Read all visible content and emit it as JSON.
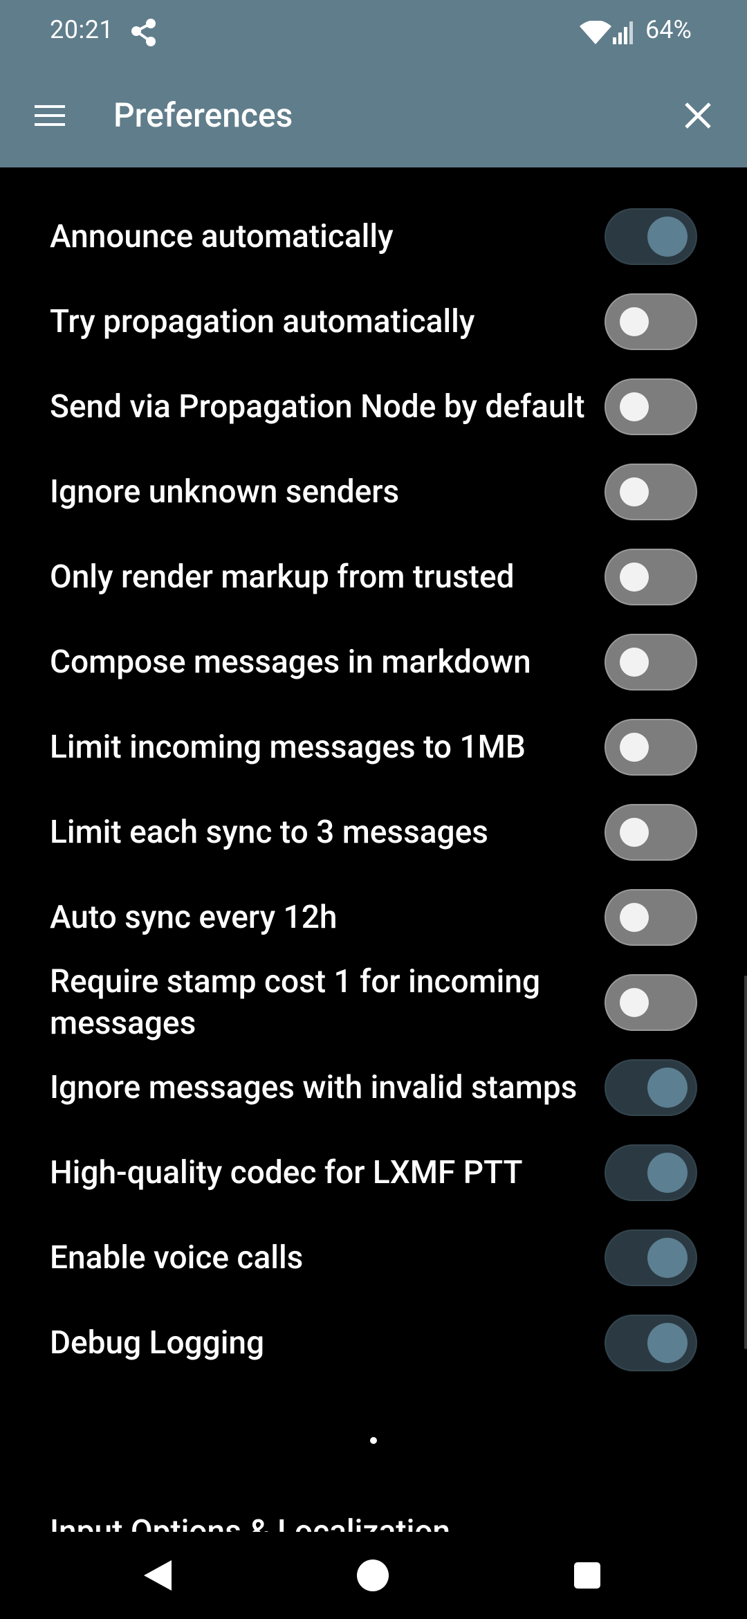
{
  "status_bar": {
    "time": "20:21",
    "battery_text": "64%",
    "icons": [
      "share-icon",
      "wifi-icon",
      "signal-icon"
    ]
  },
  "app_bar": {
    "title": "Preferences",
    "icons": [
      "menu-icon",
      "close-icon"
    ]
  },
  "settings": [
    {
      "label": "Announce automatically",
      "enabled": true
    },
    {
      "label": "Try propagation automatically",
      "enabled": false
    },
    {
      "label": "Send via Propagation Node by default",
      "enabled": false
    },
    {
      "label": "Ignore unknown senders",
      "enabled": false
    },
    {
      "label": "Only render markup from trusted",
      "enabled": false
    },
    {
      "label": "Compose messages in markdown",
      "enabled": false
    },
    {
      "label": "Limit incoming messages to 1MB",
      "enabled": false
    },
    {
      "label": "Limit each sync to 3 messages",
      "enabled": false
    },
    {
      "label": "Auto sync every 12h",
      "enabled": false
    },
    {
      "label": "Require stamp cost 1 for incoming messages",
      "enabled": false
    },
    {
      "label": "Ignore messages with invalid stamps",
      "enabled": true
    },
    {
      "label": "High-quality codec for LXMF PTT",
      "enabled": true
    },
    {
      "label": "Enable voice calls",
      "enabled": true
    },
    {
      "label": "Debug Logging",
      "enabled": true
    }
  ],
  "next_section_partial": "Input Options & Localization",
  "colors": {
    "app_bar": "#607d8b",
    "switch_on_track": "#2b3a42",
    "switch_on_knob": "#5c7f92",
    "switch_off_track": "#7d7d7d",
    "switch_off_knob": "#f2f2f2"
  },
  "nav_bar": {
    "icons": [
      "back-icon",
      "home-icon",
      "recents-icon"
    ]
  }
}
